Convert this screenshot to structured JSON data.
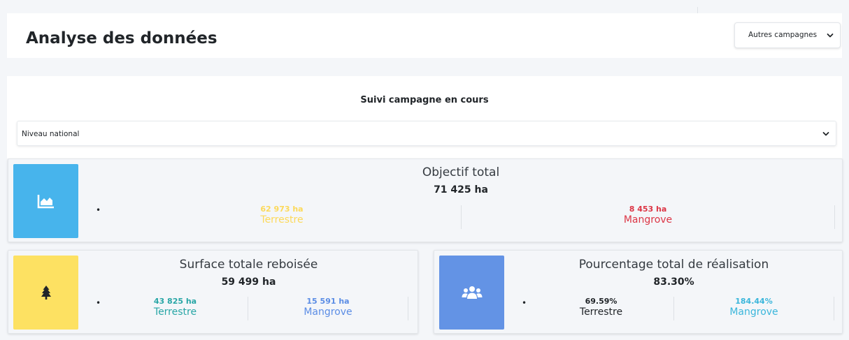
{
  "header": {
    "title": "Analyse des données",
    "campaign_select": {
      "value": "Autres campagnes",
      "icon": "chevron-down-icon"
    }
  },
  "section": {
    "title": "Suivi campagne en cours",
    "level_select": {
      "value": "Niveau national",
      "icon": "chevron-down-icon"
    }
  },
  "objective": {
    "icon": "area-chart-icon",
    "icon_color": "#47b4ec",
    "title": "Objectif total",
    "total": "71 425 ha",
    "terrestre": {
      "value": "62 973 ha",
      "label": "Terrestre",
      "color": "#fcd95a"
    },
    "mangrove": {
      "value": "8 453 ha",
      "label": "Mangrove",
      "color": "#dc3545"
    }
  },
  "surface": {
    "icon": "tree-icon",
    "icon_color": "#fde162",
    "title": "Surface totale reboisée",
    "total": "59 499 ha",
    "terrestre": {
      "value": "43 825 ha",
      "label": "Terrestre",
      "color": "#28a6a6"
    },
    "mangrove": {
      "value": "15 591 ha",
      "label": "Mangrove",
      "color": "#5b8de5"
    }
  },
  "percentage": {
    "icon": "users-icon",
    "icon_color": "#6393e5",
    "title": "Pourcentage total de réalisation",
    "total": "83.30%",
    "terrestre": {
      "value": "69.59%",
      "label": "Terrestre",
      "color": "#212529"
    },
    "mangrove": {
      "value": "184.44%",
      "label": "Mangrove",
      "color": "#3ab6db"
    }
  }
}
